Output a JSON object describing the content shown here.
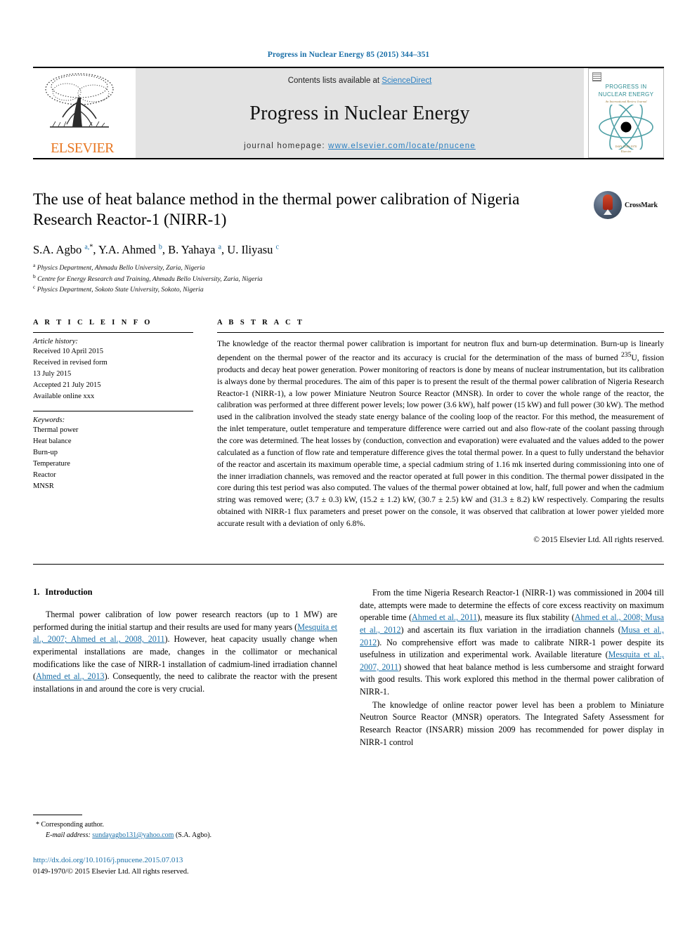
{
  "running_head": "Progress in Nuclear Energy 85 (2015) 344–351",
  "masthead": {
    "contents_prefix": "Contents lists available at ",
    "sciencedirect": "ScienceDirect",
    "journal_name": "Progress in Nuclear Energy",
    "homepage_prefix": "journal homepage: ",
    "homepage_url": "www.elsevier.com/locate/pnucene",
    "publisher": "ELSEVIER",
    "cover": {
      "line1": "PROGRESS IN",
      "line2": "NUCLEAR ENERGY",
      "line3": "An International Review Journal",
      "foot1": "ISSN 0149-1970",
      "foot2": "Elsevier"
    },
    "accent_blue": "#2a7fc1",
    "elsevier_orange": "#e87722",
    "cover_teal": "#2e8d93"
  },
  "article": {
    "title": "The use of heat balance method in the thermal power calibration of Nigeria Research Reactor-1 (NIRR-1)",
    "crossmark_label": "CrossMark",
    "authors": [
      {
        "name": "S.A. Agbo",
        "marks": "a,",
        "star": true
      },
      {
        "name": "Y.A. Ahmed",
        "marks": "b",
        "star": false
      },
      {
        "name": "B. Yahaya",
        "marks": "a",
        "star": false
      },
      {
        "name": "U. Iliyasu",
        "marks": "c",
        "star": false
      }
    ],
    "affiliations": [
      {
        "mark": "a",
        "text": "Physics Department, Ahmadu Bello University, Zaria, Nigeria"
      },
      {
        "mark": "b",
        "text": "Centre for Energy Research and Training, Ahmadu Bello University, Zaria, Nigeria"
      },
      {
        "mark": "c",
        "text": "Physics Department, Sokoto State University, Sokoto, Nigeria"
      }
    ]
  },
  "article_info": {
    "heading": "A R T I C L E   I N F O",
    "history_label": "Article history:",
    "history": [
      "Received 10 April 2015",
      "Received in revised form",
      "13 July 2015",
      "Accepted 21 July 2015",
      "Available online xxx"
    ],
    "keywords_label": "Keywords:",
    "keywords": [
      "Thermal power",
      "Heat balance",
      "Burn-up",
      "Temperature",
      "Reactor",
      "MNSR"
    ]
  },
  "abstract": {
    "heading": "A B S T R A C T",
    "part1": "The knowledge of the reactor thermal power calibration is important for neutron flux and burn-up determination. Burn-up is linearly dependent on the thermal power of the reactor and its accuracy is crucial for the determination of the mass of burned ",
    "isotope_sup": "235",
    "isotope": "U",
    "part2": ", fission products and decay heat power generation. Power monitoring of reactors is done by means of nuclear instrumentation, but its calibration is always done by thermal procedures. The aim of this paper is to present the result of the thermal power calibration of Nigeria Research Reactor-1 (NIRR-1), a low power Miniature Neutron Source Reactor (MNSR). In order to cover the whole range of the reactor, the calibration was performed at three different power levels; low power (3.6 kW), half power (15 kW) and full power (30 kW). The method used in the calibration involved the steady state energy balance of the cooling loop of the reactor. For this method, the measurement of the inlet temperature, outlet temperature and temperature difference were carried out and also flow-rate of the coolant passing through the core was determined. The heat losses by (conduction, convection and evaporation) were evaluated and the values added to the power calculated as a function of flow rate and temperature difference gives the total thermal power. In a quest to fully understand the behavior of the reactor and ascertain its maximum operable time, a special cadmium string of 1.16 mk inserted during commissioning into one of the inner irradiation channels, was removed and the reactor operated at full power in this condition. The thermal power dissipated in the core during this test period was also computed. The values of the thermal power obtained at low, half, full power and when the cadmium string was removed were; (3.7 ± 0.3) kW, (15.2 ± 1.2) kW, (30.7 ± 2.5) kW and (31.3 ± 8.2) kW respectively. Comparing the results obtained with NIRR-1 flux parameters and preset power on the console, it was observed that calibration at lower power yielded more accurate result with a deviation of only 6.8%.",
    "copyright": "© 2015 Elsevier Ltd. All rights reserved."
  },
  "body": {
    "section1_number": "1.",
    "section1_title": "Introduction",
    "left_p1_a": "Thermal power calibration of low power research reactors (up to 1 MW) are performed during the initial startup and their results are used for many years (",
    "left_p1_ref1": "Mesquita et al., 2007; Ahmed et al., 2008, 2011",
    "left_p1_b": "). However, heat capacity usually change when experimental installations are made, changes in the collimator or mechanical modifications like the case of NIRR-1 installation of cadmium-lined irradiation channel (",
    "left_p1_ref2": "Ahmed et al., 2013",
    "left_p1_c": "). Consequently, the need to calibrate the reactor with the present installations in and around the core is very crucial.",
    "right_p1_a": "From the time Nigeria Research Reactor-1 (NIRR-1) was commissioned in 2004 till date, attempts were made to determine the effects of core excess reactivity on maximum operable time (",
    "right_p1_ref1": "Ahmed et al., 2011",
    "right_p1_b": "), measure its flux stability (",
    "right_p1_ref2": "Ahmed et al., 2008; Musa et al., 2012",
    "right_p1_c": ") and ascertain its flux variation in the irradiation channels (",
    "right_p1_ref3": "Musa et al., 2012",
    "right_p1_d": "). No comprehensive effort was made to calibrate NIRR-1 power despite its usefulness in utilization and experimental work. Available literature (",
    "right_p1_ref4": "Mesquita et al., 2007, 2011",
    "right_p1_e": ") showed that heat balance method is less cumbersome and straight forward with good results. This work explored this method in the thermal power calibration of NIRR-1.",
    "right_p2": "The knowledge of online reactor power level has been a problem to Miniature Neutron Source Reactor (MNSR) operators. The Integrated Safety Assessment for Research Reactor (INSARR) mission 2009 has recommended for power display in NIRR-1 control"
  },
  "footnote": {
    "star": "*",
    "corresponding": "Corresponding author.",
    "email_label": "E-mail address:",
    "email": "sundayagbo131@yahoo.com",
    "email_owner": "(S.A. Agbo)."
  },
  "footer": {
    "doi": "http://dx.doi.org/10.1016/j.pnucene.2015.07.013",
    "issn_line": "0149-1970/© 2015 Elsevier Ltd. All rights reserved."
  }
}
